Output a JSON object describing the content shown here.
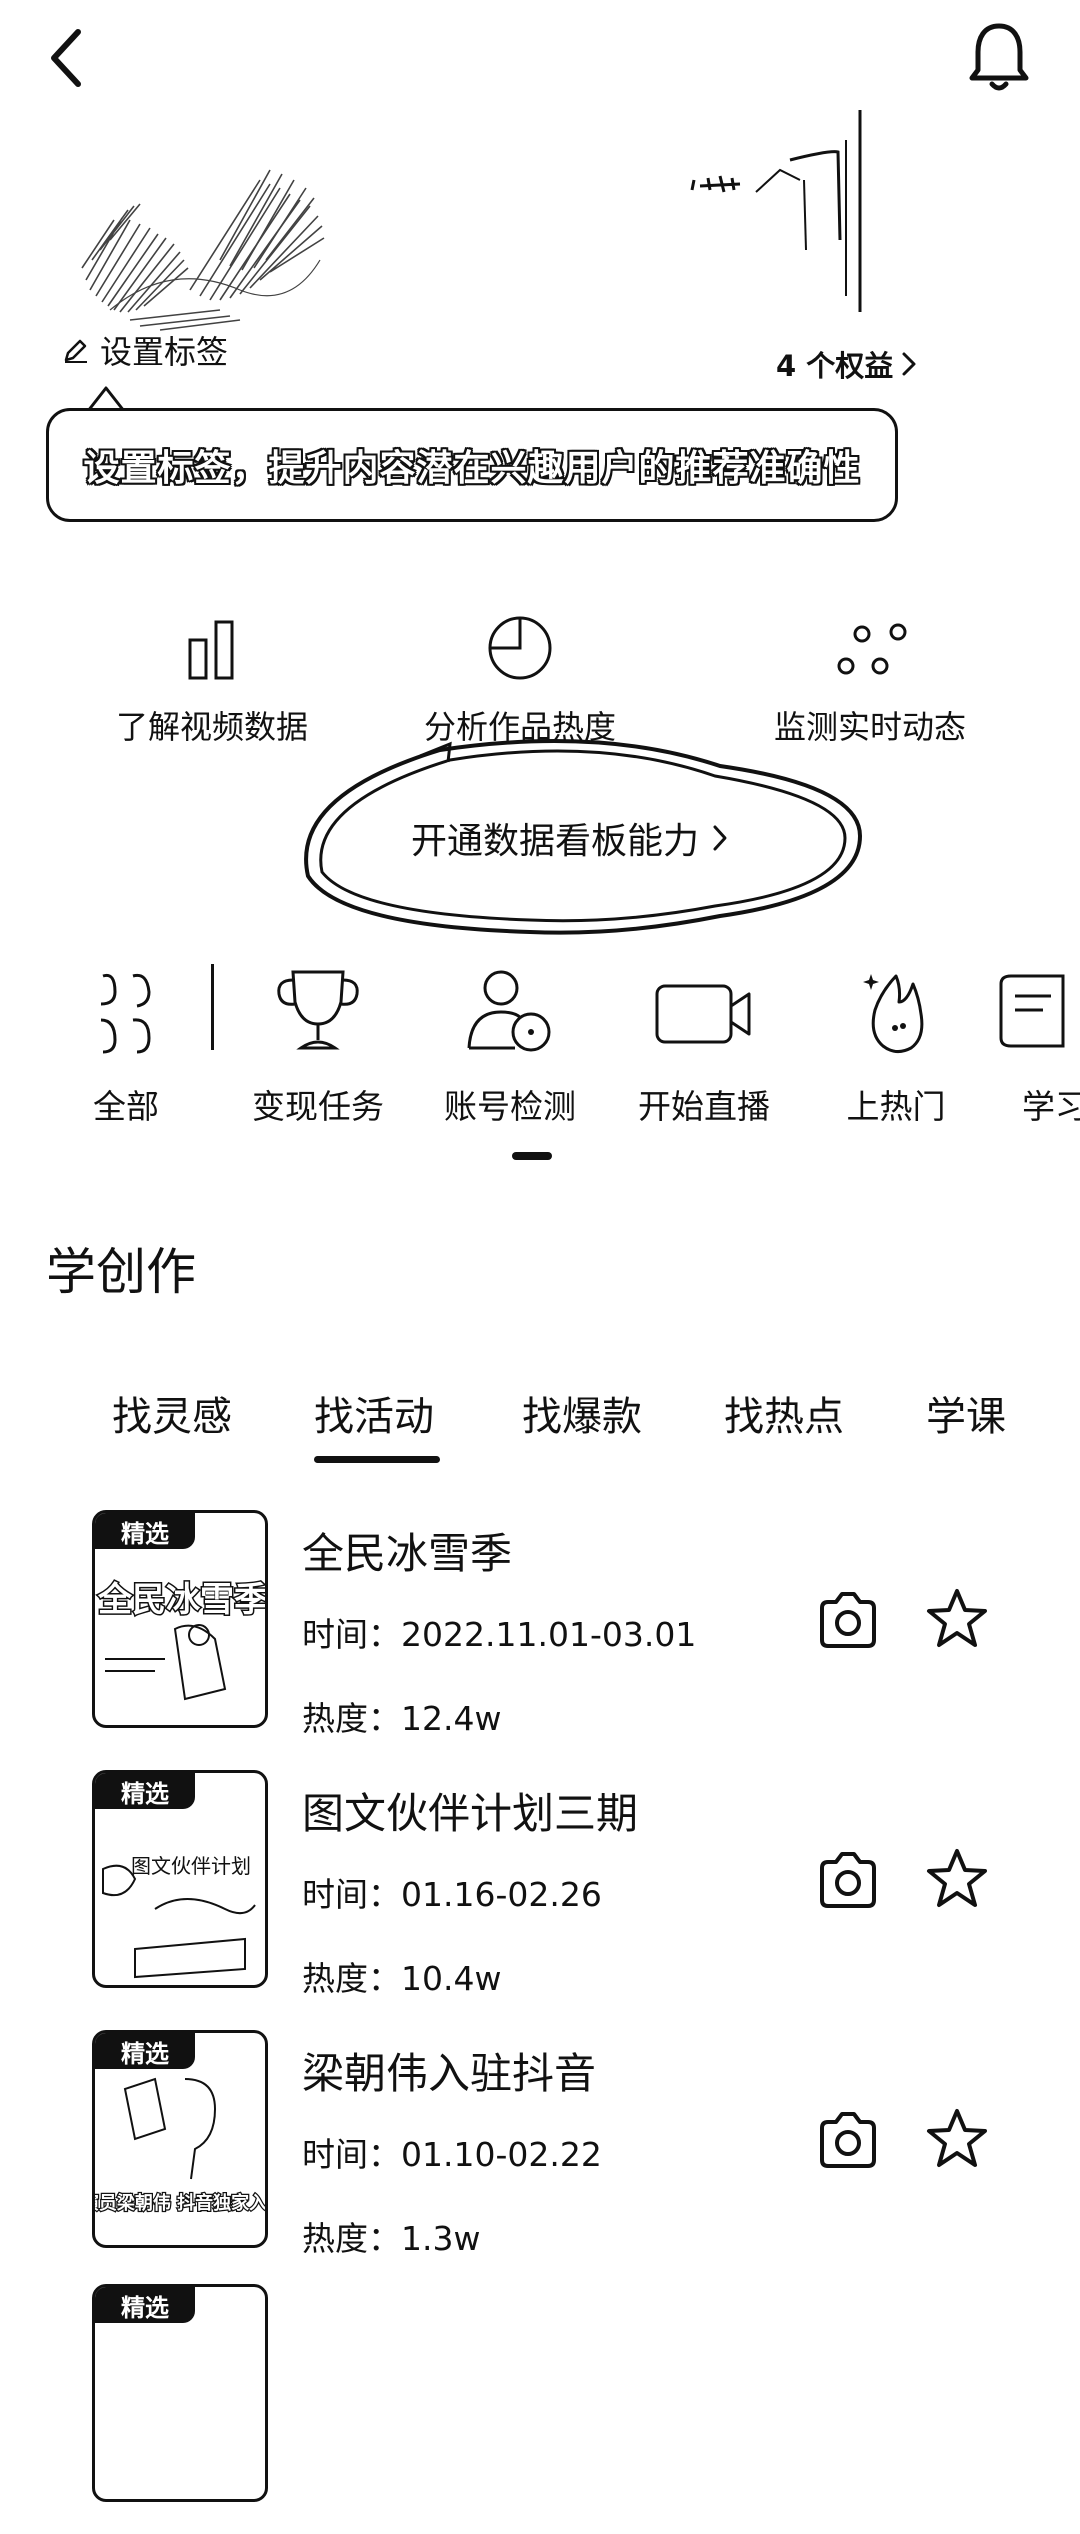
{
  "header": {
    "back_icon": "chevron-left-icon",
    "bell_icon": "bell-icon",
    "set_tag_label": "设置标签",
    "benefits_label": "4 个权益"
  },
  "tooltip": {
    "text": "设置标签，提升内容潜在兴趣用户的推荐准确性"
  },
  "features": [
    {
      "label": "了解视频数据",
      "icon": "bar-chart-icon"
    },
    {
      "label": "分析作品热度",
      "icon": "pie-chart-icon"
    },
    {
      "label": "监测实时动态",
      "icon": "dots-icon"
    }
  ],
  "board_button": {
    "label": "开通数据看板能力"
  },
  "tools": [
    {
      "label": "全部",
      "icon": "grid-icon"
    },
    {
      "label": "变现任务",
      "icon": "trophy-icon"
    },
    {
      "label": "账号检测",
      "icon": "account-check-icon"
    },
    {
      "label": "开始直播",
      "icon": "video-camera-icon"
    },
    {
      "label": "上热门",
      "icon": "flame-icon"
    },
    {
      "label": "学习",
      "icon": "book-icon"
    }
  ],
  "section": {
    "title": "学创作"
  },
  "tabs": [
    {
      "label": "找灵感"
    },
    {
      "label": "找活动"
    },
    {
      "label": "找爆款"
    },
    {
      "label": "找热点"
    },
    {
      "label": "学课"
    }
  ],
  "active_tab": "找活动",
  "activities": [
    {
      "badge": "精选",
      "title": "全民冰雪季",
      "time": "时间：2022.11.01-03.01",
      "heat": "热度：12.4w",
      "thumb_text": "全民冰雪季"
    },
    {
      "badge": "精选",
      "title": "图文伙伴计划三期",
      "time": "时间：01.16-02.26",
      "heat": "热度：10.4w",
      "thumb_text": "图文伙伴计划"
    },
    {
      "badge": "精选",
      "title": "梁朝伟入驻抖音",
      "time": "时间：01.10-02.22",
      "heat": "热度：1.3w",
      "thumb_text": "演员梁朝伟 抖音独家入驻"
    },
    {
      "badge": "精选",
      "title": "",
      "time": "",
      "heat": "",
      "thumb_text": ""
    }
  ],
  "colors": {
    "ink": "#111111",
    "background": "#ffffff"
  }
}
